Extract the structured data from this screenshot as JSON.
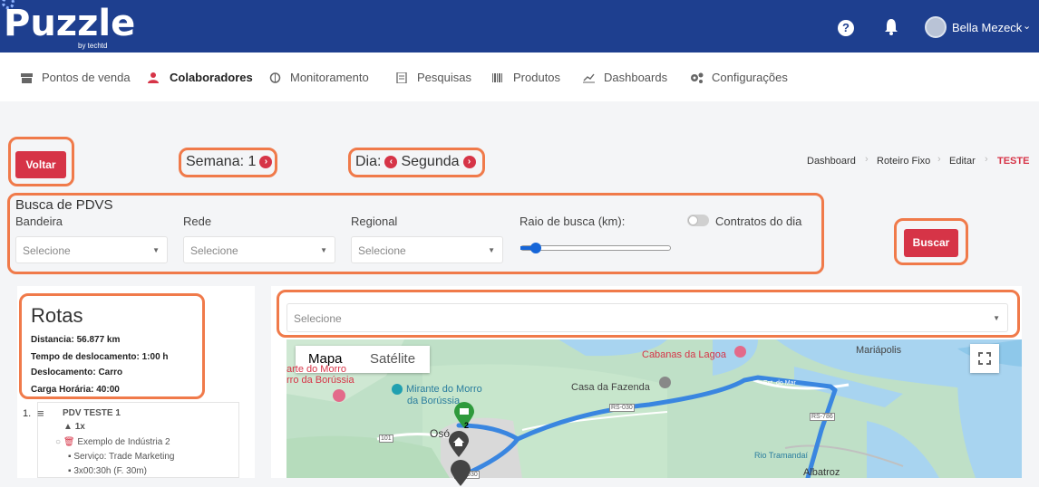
{
  "brand": {
    "name": "Puzzle",
    "sub": "by techtd"
  },
  "header": {
    "help_icon": "question-icon",
    "bell_icon": "bell-icon",
    "user_name": "Bella Mezeck",
    "caret": "⌄"
  },
  "menu": [
    {
      "label": "Pontos de venda",
      "icon": "store-icon"
    },
    {
      "label": "Colaboradores",
      "icon": "users-icon",
      "active": true
    },
    {
      "label": "Monitoramento",
      "icon": "monitor-icon"
    },
    {
      "label": "Pesquisas",
      "icon": "survey-icon"
    },
    {
      "label": "Produtos",
      "icon": "barcode-icon"
    },
    {
      "label": "Dashboards",
      "icon": "chart-icon"
    },
    {
      "label": "Configurações",
      "icon": "gears-icon"
    }
  ],
  "toolbar": {
    "back_label": "Voltar",
    "week_label": "Semana: 1",
    "day_prefix": "Dia:",
    "day_value": "Segunda"
  },
  "breadcrumb": [
    "Dashboard",
    "Roteiro Fixo",
    "Editar",
    "TESTE"
  ],
  "search": {
    "title": "Busca de PDVS",
    "bandeira_label": "Bandeira",
    "rede_label": "Rede",
    "regional_label": "Regional",
    "raio_label": "Raio de busca (km):",
    "contratos_label": "Contratos do dia",
    "placeholder": "Selecione",
    "button_label": "Buscar",
    "radius_fraction": 0.08
  },
  "routes": {
    "title": "Rotas",
    "distancia": "Distancia: 56.877 km",
    "tempo": "Tempo de deslocamento: 1:00 h",
    "deslocamento": "Deslocamento: Carro",
    "carga": "Carga Horária: 40:00",
    "item": {
      "index": "1.",
      "name": "PDV TESTE 1",
      "freq": "1x",
      "industry": "Exemplo de Indústria 2",
      "service": "Serviço: Trade Marketing",
      "time": "3x00:30h (F. 30m)"
    }
  },
  "map": {
    "select_placeholder": "Selecione",
    "tab_map": "Mapa",
    "tab_sat": "Satélite",
    "labels": {
      "cabanas": "Cabanas da Lagoa",
      "mariapolis": "Mariápolis",
      "mirante": "Mirante do Morro",
      "borussia": "da Borússia",
      "fazenda": "Casa da Fazenda",
      "morro_left": "arte do Morro",
      "morro_left2": "rro da Borússia",
      "rs030": "RS-030",
      "r101": "101",
      "rs786": "RS-786",
      "rs030b": "RS-030",
      "oso": "Osó",
      "tramandai": "Rio Tramandaí",
      "albatroz": "Albatroz",
      "estrada": "Est. do Mar"
    },
    "pin_green_num": "2",
    "accent": "#d63447",
    "route_color": "#3a86e0"
  }
}
